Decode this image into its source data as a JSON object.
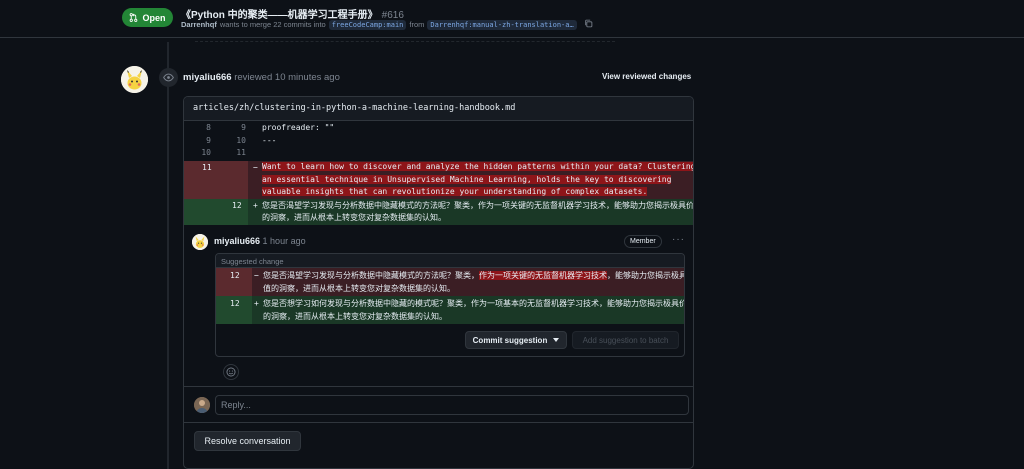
{
  "header": {
    "state_label": "Open",
    "title": "《Python 中的聚类——机器学习工程手册》",
    "number": "#616",
    "author": "Darrenhqf",
    "merge_text": "wants to merge 22 commits into",
    "base_branch": "freeCodeCamp:main",
    "from_text": "from",
    "head_branch": "Darrenhqf:manual-zh-translation-a…"
  },
  "review": {
    "reviewer": "miyaliu666",
    "action": "reviewed",
    "time": "10 minutes ago",
    "view_changes_label": "View reviewed changes"
  },
  "diff": {
    "file_path": "articles/zh/clustering-in-python-a-machine-learning-handbook.md",
    "context_lines": [
      {
        "old": "8",
        "new": "9",
        "code": "proofreader: \"\""
      },
      {
        "old": "9",
        "new": "10",
        "code": "---"
      },
      {
        "old": "10",
        "new": "11",
        "code": ""
      }
    ],
    "deleted": {
      "old": "11",
      "sign": "−",
      "lines": [
        "Want to learn how to discover and analyze the hidden patterns within your data? Clustering,",
        "an essential technique in Unsupervised Machine Learning, holds the key to discovering",
        "valuable insights that can revolutionize your understanding of complex datasets."
      ]
    },
    "added": {
      "new": "12",
      "sign": "+",
      "lines": [
        "您是否渴望学习发现与分析数据中隐藏模式的方法呢？聚类，作为一项关键的无监督机器学习技术，能够助力您揭示极具价值",
        "的洞察，进而从根本上转变您对复杂数据集的认知。"
      ]
    }
  },
  "comment": {
    "author": "miyaliu666",
    "time": "1 hour ago",
    "role_badge": "Member",
    "more_label": "···",
    "suggestion_header": "Suggested change",
    "old_num": "12",
    "old_sign": "−",
    "old_line1_pre": "您是否渴望学习发现与分析数据中隐藏模式的方法呢？聚类，",
    "old_line1_hl": "作为一项关键的无监督机器学习技术",
    "old_line1_post": "，能够助力您揭示极具价",
    "old_line2": "值的洞察，进而从根本上转变您对复杂数据集的认知。",
    "new_num": "12",
    "new_sign": "+",
    "new_line1": "您是否想学习如何发现与分析数据中隐藏的模式呢？聚类，作为一项基本的无监督机器学习技术，能够助力您揭示极具价值",
    "new_line2": "的洞察，进而从根本上转变您对复杂数据集的认知。",
    "commit_label": "Commit suggestion",
    "batch_label": "Add suggestion to batch"
  },
  "reply": {
    "placeholder": "Reply..."
  },
  "resolve_label": "Resolve conversation"
}
